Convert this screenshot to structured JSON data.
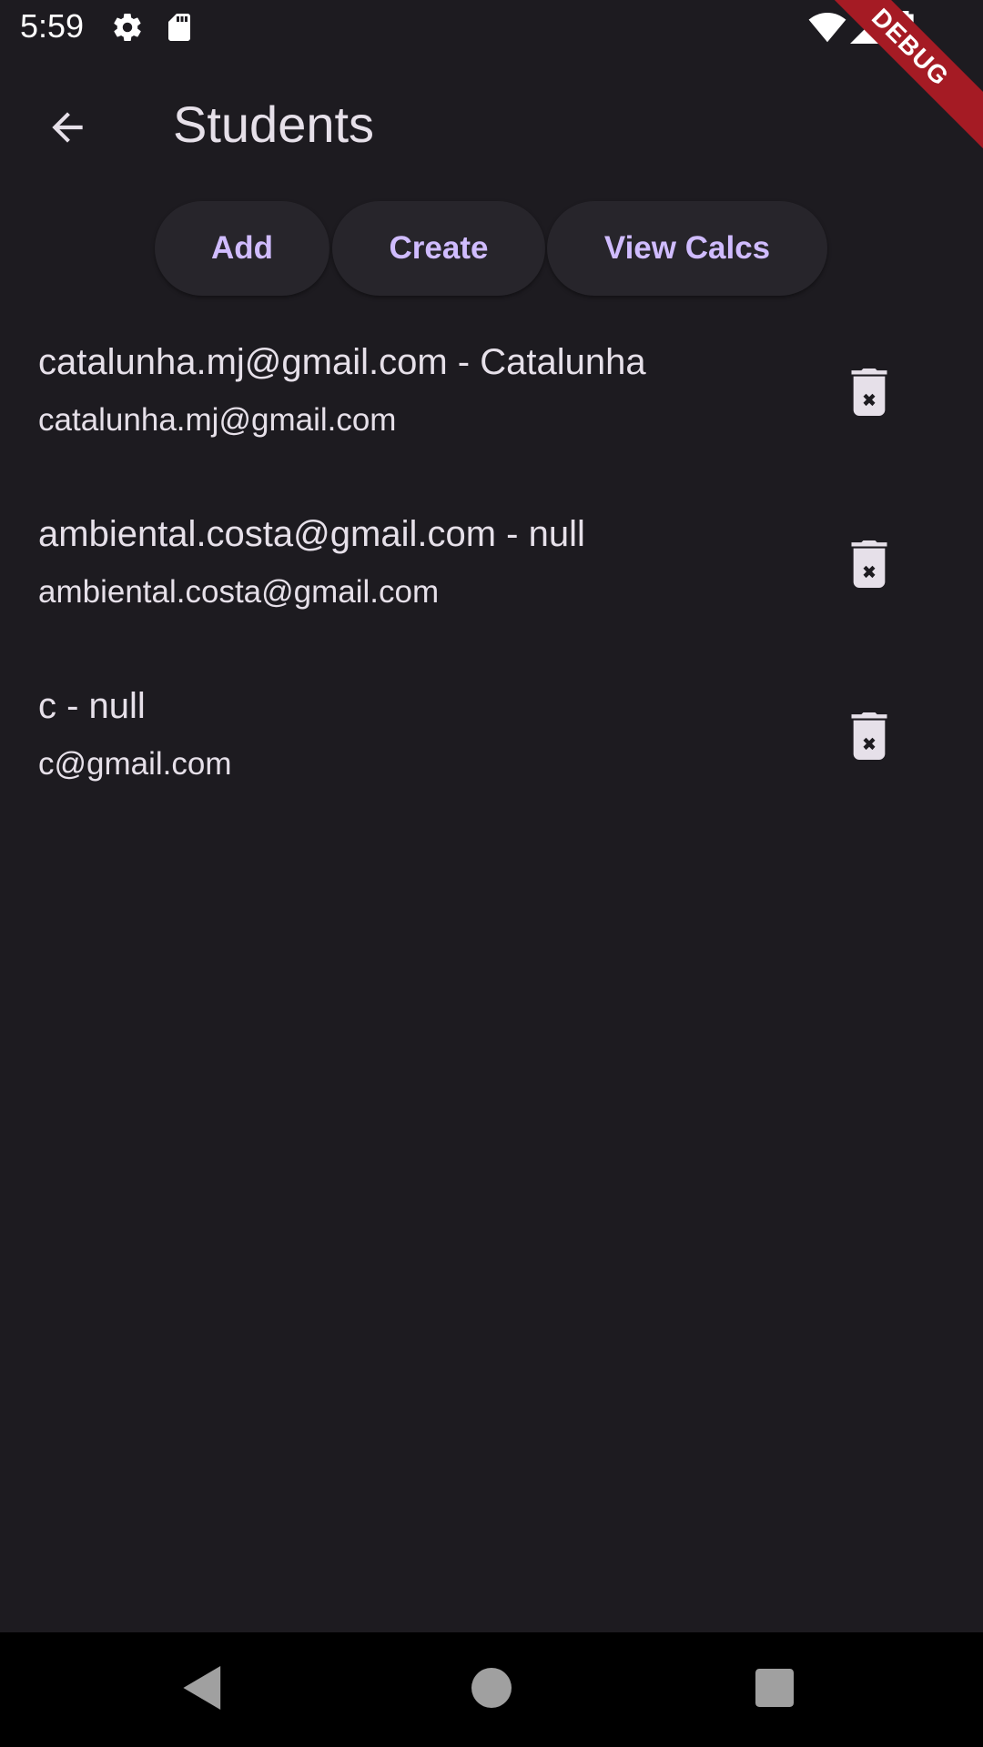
{
  "status_bar": {
    "time": "5:59",
    "icons": [
      "settings-icon",
      "sd-card-icon",
      "wifi-icon",
      "signal-icon",
      "battery-icon"
    ]
  },
  "debug_banner": "DEBUG",
  "app_bar": {
    "title": "Students",
    "back_icon": "arrow-back-icon"
  },
  "actions": {
    "add_label": "Add",
    "create_label": "Create",
    "view_calcs_label": "View Calcs"
  },
  "students": [
    {
      "title": "catalunha.mj@gmail.com - Catalunha",
      "subtitle": "catalunha.mj@gmail.com"
    },
    {
      "title": "ambiental.costa@gmail.com - null",
      "subtitle": "ambiental.costa@gmail.com"
    },
    {
      "title": "c - null",
      "subtitle": "c@gmail.com"
    }
  ],
  "colors": {
    "background": "#1d1b20",
    "accent": "#d0bcff",
    "text": "#e6e0e9",
    "button_bg": "#27252b",
    "debug_banner": "#a51b24",
    "nav_bar": "#000000"
  }
}
